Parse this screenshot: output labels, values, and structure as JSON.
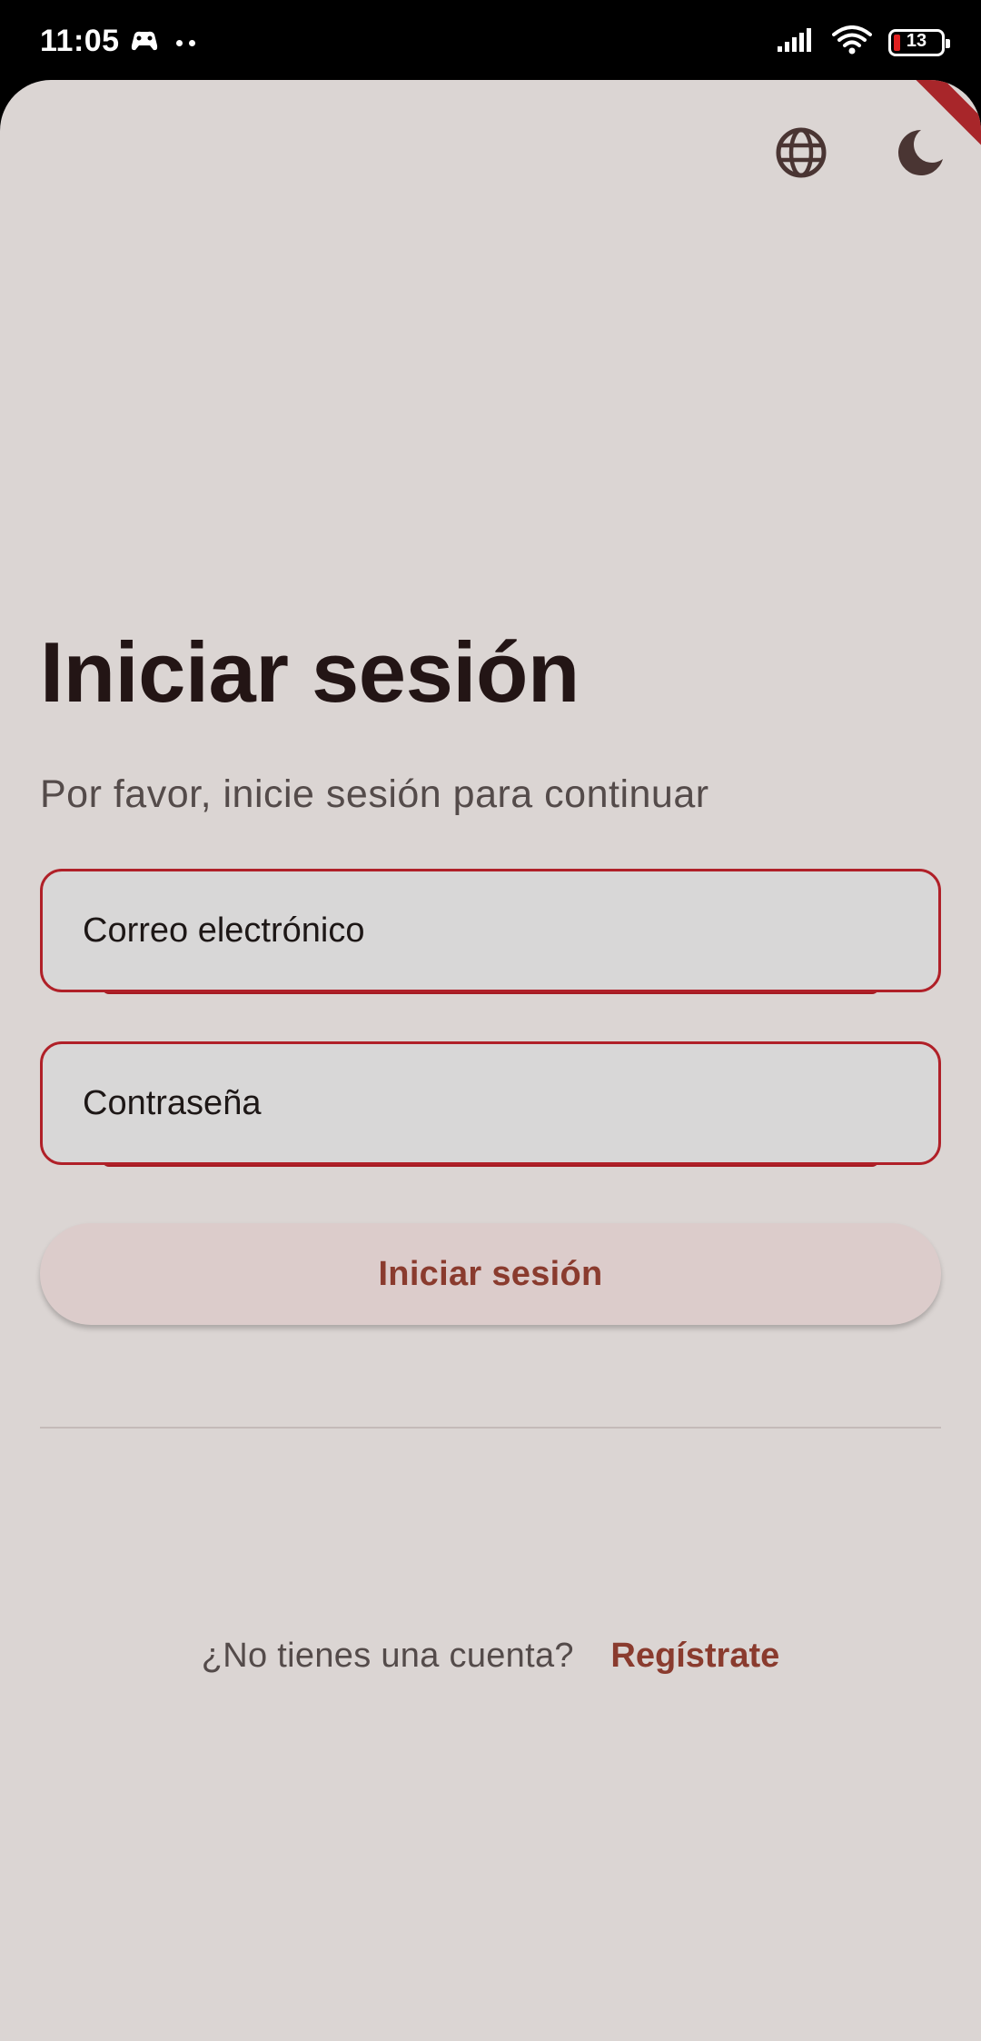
{
  "status_bar": {
    "time": "11:05",
    "battery_level": "13",
    "icons": [
      "game-controller-icon",
      "signal-icon",
      "wifi-icon",
      "battery-icon"
    ]
  },
  "top_actions": {
    "language_icon": "globe-icon",
    "theme_icon": "moon-icon"
  },
  "login": {
    "title": "Iniciar sesión",
    "subtitle": "Por favor, inicie sesión para continuar",
    "email_placeholder": "Correo electrónico",
    "password_placeholder": "Contraseña",
    "submit_label": "Iniciar sesión"
  },
  "signup": {
    "question": "¿No tienes una cuenta?",
    "link_label": "Regístrate"
  },
  "colors": {
    "background": "#dbd5d3",
    "accent": "#b02028",
    "primary_text": "#231515",
    "link": "#8a3b2e"
  }
}
